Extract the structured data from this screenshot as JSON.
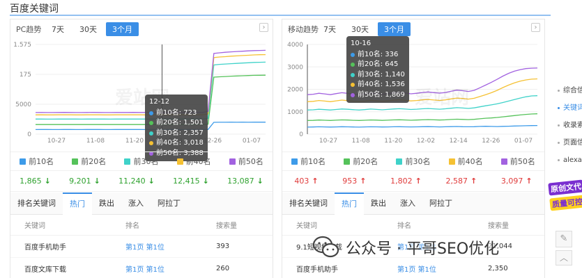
{
  "page_title": "百度关键词",
  "range_tabs": [
    "7天",
    "30天",
    "3个月"
  ],
  "legend": [
    "前10名",
    "前20名",
    "前30名",
    "前40名",
    "前50名"
  ],
  "series_colors": [
    "#3d9be9",
    "#55c25a",
    "#3fd2c9",
    "#f5c133",
    "#a262e0"
  ],
  "pc": {
    "title": "PC趋势",
    "active_range": "3个月",
    "tooltip": {
      "date": "12-12",
      "rows": [
        "前10名: 723",
        "前20名: 1,501",
        "前30名: 2,357",
        "前40名: 3,018",
        "前50名: 3,388"
      ]
    },
    "totals": [
      "1,865",
      "9,201",
      "11,240",
      "12,415",
      "13,087"
    ],
    "totals_trend": "down",
    "tabs": [
      "排名关键词",
      "热门",
      "跌出",
      "涨入",
      "阿拉丁"
    ],
    "active_tab": "热门",
    "table_headers": [
      "关键词",
      "排名",
      "搜索量"
    ],
    "rows": [
      {
        "keyword": "百度手机助手",
        "rank": "第1页 第1位",
        "volume": "393"
      },
      {
        "keyword": "百度文库下载",
        "rank": "第1页 第1位",
        "volume": "260"
      }
    ]
  },
  "mobile": {
    "title": "移动趋势",
    "active_range": "3个月",
    "tooltip": {
      "date": "10-16",
      "rows": [
        "前10名: 336",
        "前20名: 645",
        "前30名: 1,140",
        "前40名: 1,536",
        "前50名: 1,869"
      ]
    },
    "totals": [
      "403",
      "953",
      "1,802",
      "2,587",
      "3,097"
    ],
    "totals_trend": "up",
    "tabs": [
      "排名关键词",
      "热门",
      "跌出",
      "涨入",
      "阿拉丁"
    ],
    "active_tab": "热门",
    "table_headers": [
      "关键词",
      "排名",
      "搜索量"
    ],
    "rows": [
      {
        "keyword": "9.1短视频下载",
        "rank": "第1页 第1位",
        "volume": "21,044"
      },
      {
        "keyword": "百度手机助手",
        "rank": "第1页 第1位",
        "volume": "2,350"
      }
    ]
  },
  "side_nav": [
    "综合信",
    "关键词",
    "收录索",
    "页面信",
    "alexa"
  ],
  "side_nav_active": 1,
  "promo": {
    "line1": "原创文代",
    "line2": "质量可控"
  },
  "watermark": {
    "text": "公众号 · 平哥SEO优化"
  },
  "ghost_logo": "爱站网",
  "chart_data": [
    {
      "type": "line",
      "title": "PC趋势",
      "x_ticks": [
        "10-27",
        "11-08",
        "11-20",
        "12-14",
        "12-26",
        "01-07"
      ],
      "y_ticks": [
        "0",
        "5000",
        "175",
        "1.575"
      ],
      "series": [
        {
          "name": "前10名",
          "values": [
            720,
            725,
            722,
            718,
            720,
            724,
            723,
            721,
            719,
            722,
            725,
            723,
            720,
            718,
            722,
            724,
            723,
            726,
            722,
            720,
            723,
            725,
            721,
            724,
            723,
            722,
            720,
            725,
            726,
            724,
            723,
            1850,
            1860,
            1855,
            1862,
            1858,
            1865,
            1860,
            1863,
            1866,
            1865
          ]
        },
        {
          "name": "前20名",
          "values": [
            1500,
            1505,
            1498,
            1495,
            1502,
            1506,
            1501,
            1499,
            1497,
            1503,
            1506,
            1501,
            1499,
            1496,
            1502,
            1505,
            1501,
            1507,
            1503,
            1500,
            1502,
            1505,
            1500,
            1504,
            1501,
            1502,
            1499,
            1505,
            1506,
            1503,
            1550,
            8900,
            8950,
            9000,
            9050,
            9080,
            9120,
            9150,
            9180,
            9190,
            9201
          ]
        },
        {
          "name": "前30名",
          "values": [
            2350,
            2356,
            2349,
            2344,
            2352,
            2358,
            2357,
            2350,
            2347,
            2354,
            2358,
            2357,
            2350,
            2346,
            2353,
            2357,
            2355,
            2360,
            2354,
            2351,
            2353,
            2357,
            2352,
            2356,
            2357,
            2355,
            2351,
            2358,
            2360,
            2356,
            2450,
            10800,
            10900,
            10950,
            11000,
            11050,
            11100,
            11150,
            11200,
            11220,
            11240
          ]
        },
        {
          "name": "前40名",
          "values": [
            3010,
            3018,
            3008,
            3002,
            3013,
            3020,
            3018,
            3011,
            3006,
            3014,
            3020,
            3018,
            3010,
            3005,
            3015,
            3019,
            3017,
            3022,
            3015,
            3011,
            3014,
            3019,
            3012,
            3018,
            3018,
            3016,
            3011,
            3020,
            3022,
            3017,
            3150,
            11950,
            12050,
            12100,
            12180,
            12220,
            12270,
            12320,
            12370,
            12400,
            12415
          ]
        },
        {
          "name": "前50名",
          "values": [
            3380,
            3389,
            3378,
            3372,
            3384,
            3392,
            3388,
            3380,
            3375,
            3385,
            3392,
            3388,
            3380,
            3374,
            3386,
            3390,
            3388,
            3394,
            3386,
            3381,
            3385,
            3390,
            3382,
            3389,
            3388,
            3386,
            3381,
            3392,
            3394,
            3388,
            3550,
            12600,
            12700,
            12780,
            12850,
            12900,
            12950,
            13000,
            13040,
            13070,
            13087
          ]
        }
      ],
      "ylim": [
        0,
        14000
      ],
      "crosshair_index": 22,
      "grid": true
    },
    {
      "type": "line",
      "title": "移动趋势",
      "x_ticks": [
        "10-27",
        "11-08",
        "11-20",
        "12-02",
        "12-14",
        "12-26",
        "01-07"
      ],
      "y_ticks": [
        "0",
        "1000",
        "2000",
        "3000",
        "4000"
      ],
      "series": [
        {
          "name": "前10名",
          "values": [
            330,
            336,
            345,
            338,
            332,
            340,
            348,
            342,
            335,
            330,
            338,
            346,
            341,
            334,
            339,
            345,
            350,
            343,
            337,
            341,
            348,
            352,
            346,
            340,
            345,
            352,
            358,
            350,
            345,
            350,
            360,
            368,
            362,
            356,
            365,
            372,
            380,
            388,
            395,
            400,
            403
          ]
        },
        {
          "name": "前20名",
          "values": [
            640,
            645,
            660,
            652,
            640,
            655,
            668,
            660,
            648,
            640,
            652,
            665,
            658,
            645,
            655,
            668,
            675,
            664,
            652,
            660,
            672,
            680,
            670,
            662,
            672,
            688,
            700,
            690,
            680,
            695,
            720,
            745,
            760,
            780,
            810,
            840,
            870,
            900,
            925,
            945,
            953
          ]
        },
        {
          "name": "前30名",
          "values": [
            1130,
            1140,
            1165,
            1150,
            1130,
            1155,
            1180,
            1165,
            1145,
            1130,
            1150,
            1175,
            1160,
            1140,
            1158,
            1178,
            1192,
            1175,
            1155,
            1168,
            1188,
            1200,
            1185,
            1170,
            1188,
            1215,
            1240,
            1225,
            1205,
            1230,
            1280,
            1330,
            1370,
            1420,
            1480,
            1550,
            1620,
            1690,
            1750,
            1790,
            1802
          ]
        },
        {
          "name": "前40名",
          "values": [
            1520,
            1536,
            1575,
            1550,
            1520,
            1560,
            1595,
            1570,
            1540,
            1520,
            1548,
            1585,
            1562,
            1535,
            1560,
            1590,
            1610,
            1585,
            1555,
            1575,
            1605,
            1625,
            1600,
            1580,
            1605,
            1650,
            1690,
            1670,
            1640,
            1680,
            1760,
            1850,
            1940,
            2050,
            2180,
            2300,
            2400,
            2480,
            2540,
            2575,
            2587
          ]
        },
        {
          "name": "前50名",
          "values": [
            1850,
            1869,
            1915,
            1885,
            1850,
            1898,
            1940,
            1910,
            1875,
            1850,
            1882,
            1925,
            1900,
            1868,
            1895,
            1935,
            1960,
            1930,
            1890,
            1915,
            1950,
            1975,
            1945,
            1920,
            1950,
            2010,
            2060,
            2035,
            2000,
            2050,
            2170,
            2300,
            2430,
            2570,
            2720,
            2850,
            2950,
            3020,
            3070,
            3090,
            3097
          ]
        }
      ],
      "ylim": [
        0,
        4200
      ],
      "crosshair_index": 0,
      "grid": true
    }
  ]
}
